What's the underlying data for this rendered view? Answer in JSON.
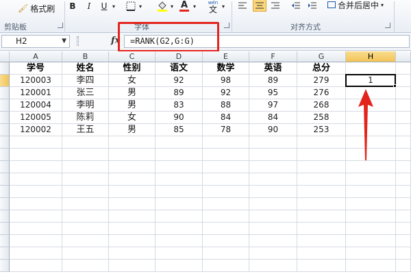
{
  "ribbon": {
    "format_painter_label": "格式刷",
    "clipboard_group_label": "剪贴板",
    "bold_label": "B",
    "italic_label": "I",
    "underline_label": "U",
    "font_color_label": "A",
    "wen_label": "文",
    "wen_top_label": "wén",
    "font_group_label": "字体",
    "alignment_group_label": "对齐方式",
    "merge_center_label": "合并后居中"
  },
  "formula_bar": {
    "name_box": "H2",
    "fx_label": "fx",
    "formula": "=RANK(G2,G:G)"
  },
  "columns": [
    "A",
    "B",
    "C",
    "D",
    "E",
    "F",
    "G",
    "H"
  ],
  "active_column": "H",
  "table": {
    "headers": [
      "学号",
      "姓名",
      "性别",
      "语文",
      "数学",
      "英语",
      "总分"
    ],
    "rows": [
      [
        "120003",
        "李四",
        "女",
        "92",
        "98",
        "89",
        "279",
        "1"
      ],
      [
        "120001",
        "张三",
        "男",
        "89",
        "92",
        "95",
        "276",
        ""
      ],
      [
        "120004",
        "李明",
        "男",
        "83",
        "88",
        "97",
        "268",
        ""
      ],
      [
        "120005",
        "陈莉",
        "女",
        "90",
        "84",
        "84",
        "258",
        ""
      ],
      [
        "120002",
        "王五",
        "男",
        "85",
        "78",
        "90",
        "253",
        ""
      ]
    ]
  },
  "colors": {
    "annotation_red": "#e3241c",
    "active_header": "#f2c457"
  }
}
